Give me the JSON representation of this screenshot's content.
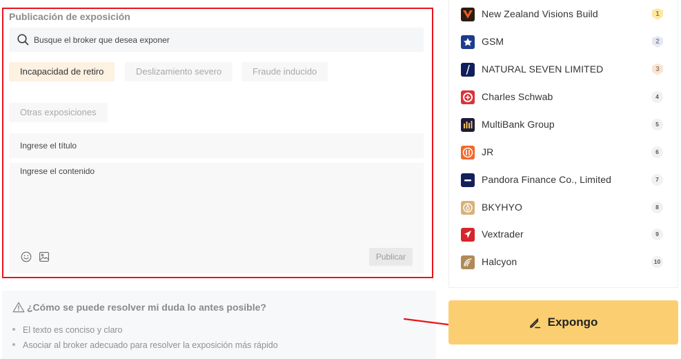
{
  "form": {
    "title": "Publicación de exposición",
    "search_placeholder": "Busque el broker que desea exponer",
    "categories": [
      {
        "label": "Incapacidad de retiro",
        "active": true
      },
      {
        "label": "Deslizamiento severo",
        "active": false
      },
      {
        "label": "Fraude inducido",
        "active": false
      },
      {
        "label": "Otras exposiciones",
        "active": false
      }
    ],
    "title_placeholder": "Ingrese el título",
    "content_placeholder": "Ingrese el contenido",
    "publish_label": "Publicar",
    "toolbar_icons": [
      "emoji-icon",
      "image-icon"
    ]
  },
  "tips": {
    "title": "¿Cómo se puede resolver mi duda lo antes posible?",
    "items": [
      "El texto es conciso y claro",
      "Asociar al broker adecuado para resolver la exposición más rápido"
    ]
  },
  "ranking": [
    {
      "name": "New Zealand Visions Build",
      "rank": "1",
      "logo_color": "#2b1b13",
      "accent": "#e85a1f"
    },
    {
      "name": "GSM",
      "rank": "2",
      "logo_color": "#1d3c8f",
      "accent": "#ffffff"
    },
    {
      "name": "NATURAL SEVEN LIMITED",
      "rank": "3",
      "logo_color": "#0f1f5c",
      "accent": "#ffffff"
    },
    {
      "name": "Charles Schwab",
      "rank": "4",
      "logo_color": "#d9343a",
      "accent": "#ffffff"
    },
    {
      "name": "MultiBank Group",
      "rank": "5",
      "logo_color": "#1c1c3a",
      "accent": "#f2c14e"
    },
    {
      "name": "JR",
      "rank": "6",
      "logo_color": "#f06a2a",
      "accent": "#ffffff"
    },
    {
      "name": "Pandora Finance Co., Limited",
      "rank": "7",
      "logo_color": "#14205c",
      "accent": "#ffffff"
    },
    {
      "name": "BKYHYO",
      "rank": "8",
      "logo_color": "#d8b27a",
      "accent": "#ffffff"
    },
    {
      "name": "Vextrader",
      "rank": "9",
      "logo_color": "#d6252b",
      "accent": "#ffffff"
    },
    {
      "name": "Halcyon",
      "rank": "10",
      "logo_color": "#b08a5a",
      "accent": "#ffffff"
    }
  ],
  "cta": {
    "label": "Expongo",
    "color": "#fbce72"
  },
  "colors": {
    "highlight_border": "#e8131a",
    "annotation_arrow": "#e8131a",
    "active_chip_bg": "#fdf1e2"
  }
}
